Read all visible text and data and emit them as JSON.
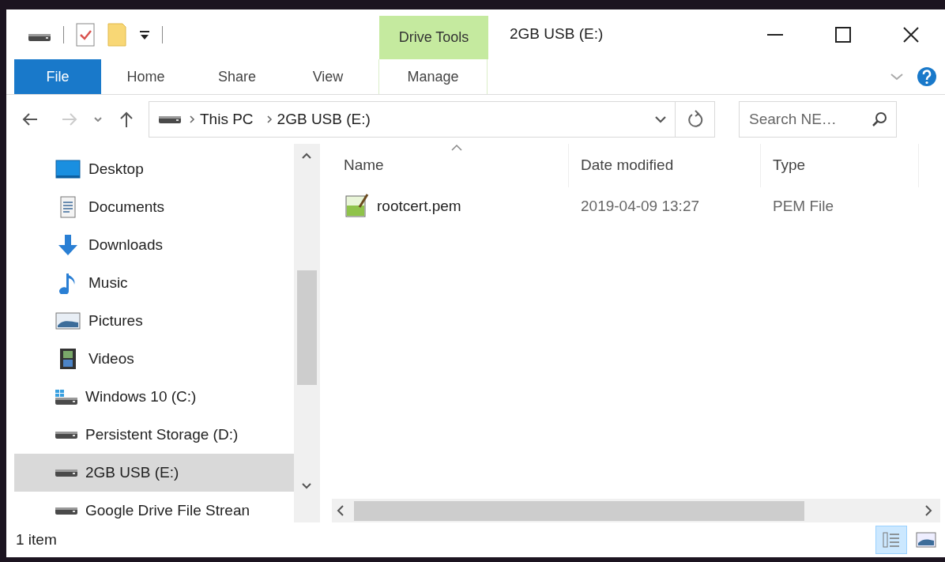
{
  "window": {
    "title": "2GB USB (E:)"
  },
  "contextual_tab_group": {
    "label": "Drive Tools"
  },
  "ribbon_tabs": [
    {
      "label": "File",
      "kind": "file",
      "selected": false
    },
    {
      "label": "Home",
      "kind": "plain",
      "selected": false
    },
    {
      "label": "Share",
      "kind": "plain",
      "selected": false
    },
    {
      "label": "View",
      "kind": "plain",
      "selected": false
    },
    {
      "label": "Manage",
      "kind": "contextual",
      "selected": false
    }
  ],
  "address_bar": {
    "breadcrumbs": [
      "This PC",
      "2GB USB (E:)"
    ]
  },
  "search": {
    "placeholder": "Search NE…"
  },
  "nav_pane": {
    "items": [
      {
        "label": "Desktop",
        "kind": "desktop",
        "selected": false
      },
      {
        "label": "Documents",
        "kind": "documents",
        "selected": false
      },
      {
        "label": "Downloads",
        "kind": "downloads",
        "selected": false
      },
      {
        "label": "Music",
        "kind": "music",
        "selected": false
      },
      {
        "label": "Pictures",
        "kind": "pictures",
        "selected": false
      },
      {
        "label": "Videos",
        "kind": "videos",
        "selected": false
      },
      {
        "label": "Windows 10 (C:)",
        "kind": "system-drive",
        "selected": false
      },
      {
        "label": "Persistent Storage (D:)",
        "kind": "drive",
        "selected": false
      },
      {
        "label": "2GB USB (E:)",
        "kind": "drive",
        "selected": true
      },
      {
        "label": "Google Drive File Strean",
        "kind": "drive",
        "selected": false
      }
    ]
  },
  "columns": [
    {
      "label": "Name",
      "sorted": true
    },
    {
      "label": "Date modified",
      "sorted": false
    },
    {
      "label": "Type",
      "sorted": false
    }
  ],
  "files": [
    {
      "name": "rootcert.pem",
      "date_modified": "2019-04-09 13:27",
      "type": "PEM File",
      "selected": false
    }
  ],
  "status_bar": {
    "item_count": "1 item"
  },
  "view_buttons": [
    {
      "kind": "details",
      "selected": true
    },
    {
      "kind": "large-icons",
      "selected": false
    }
  ]
}
